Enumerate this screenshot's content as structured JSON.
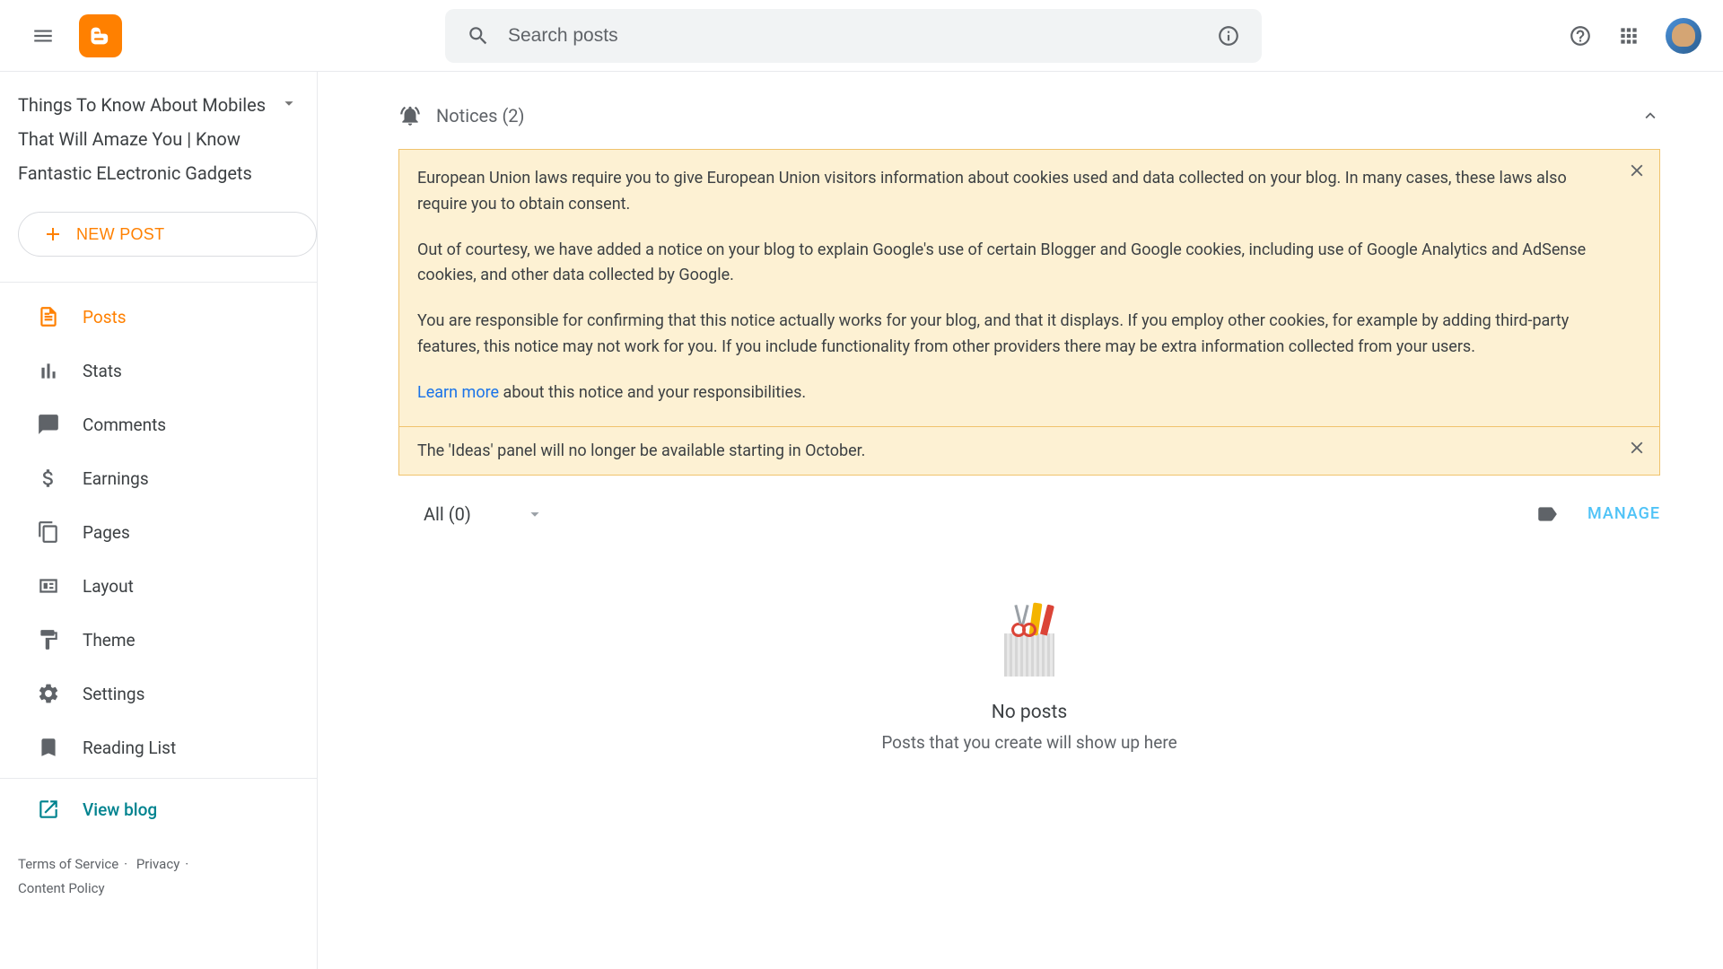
{
  "header": {
    "search_placeholder": "Search posts"
  },
  "sidebar": {
    "blog_title": "Things To Know About Mobiles That Will Amaze You | Know Fantastic ELectronic Gadgets",
    "new_post_label": "NEW POST",
    "items": [
      {
        "label": "Posts"
      },
      {
        "label": "Stats"
      },
      {
        "label": "Comments"
      },
      {
        "label": "Earnings"
      },
      {
        "label": "Pages"
      },
      {
        "label": "Layout"
      },
      {
        "label": "Theme"
      },
      {
        "label": "Settings"
      },
      {
        "label": "Reading List"
      }
    ],
    "view_blog_label": "View blog",
    "footer": {
      "terms": "Terms of Service",
      "privacy": "Privacy",
      "content_policy": "Content Policy"
    }
  },
  "main": {
    "notices_label": "Notices (2)",
    "notice1": {
      "p1": "European Union laws require you to give European Union visitors information about cookies used and data collected on your blog. In many cases, these laws also require you to obtain consent.",
      "p2": "Out of courtesy, we have added a notice on your blog to explain Google's use of certain Blogger and Google cookies, including use of Google Analytics and AdSense cookies, and other data collected by Google.",
      "p3": "You are responsible for confirming that this notice actually works for your blog, and that it displays. If you employ other cookies, for example by adding third-party features, this notice may not work for you. If you include functionality from other providers there may be extra information collected from your users.",
      "learn_more": "Learn more",
      "learn_more_tail": " about this notice and your responsibilities."
    },
    "notice2": "The 'Ideas' panel will no longer be available starting in October.",
    "filter_label": "All (0)",
    "manage_label": "MANAGE",
    "empty_title": "No posts",
    "empty_sub": "Posts that you create will show up here"
  }
}
